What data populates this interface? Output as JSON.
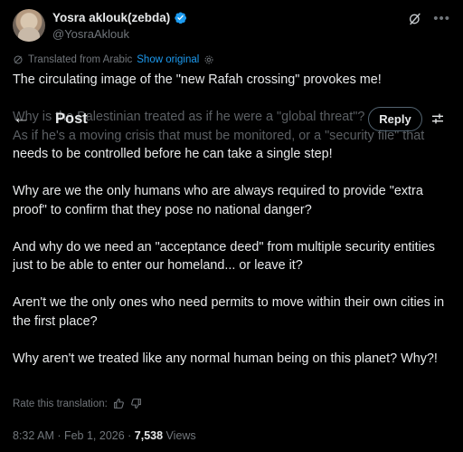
{
  "author": {
    "name": "Yosra aklouk(zebda)",
    "handle": "@YosraAklouk"
  },
  "translation": {
    "label": "Translated from Arabic",
    "show_original": "Show original"
  },
  "nav": {
    "title": "Post",
    "reply_label": "Reply"
  },
  "post": {
    "line1": "The circulating image of the \"new Rafah crossing\" provokes me!",
    "para2_a": "Why is the Palestinian treated as if he were a \"global threat\"?",
    "para2_b": "As if he's a moving crisis that must be monitored, or a \"security file\" that",
    "para2_c": "needs to be controlled before he can take a single step!",
    "para3": "Why are we the only humans who are always required to provide \"extra proof\" to confirm that they pose no national danger?",
    "para4": "And why do we need an \"acceptance deed\" from multiple security entities just to be able to enter our homeland... or leave it?",
    "para5": "Aren't we the only ones who need permits to move within their own cities in the first place?",
    "para6": "Why aren't we treated like any normal human being on this planet? Why?!"
  },
  "rate": {
    "label": "Rate this translation:"
  },
  "meta": {
    "time_date": "8:32 AM · Feb 1, 2026 · ",
    "views_count": "7,538",
    "views_label": " Views"
  },
  "colors": {
    "background": "#000000",
    "text": "#e7e9ea",
    "secondary": "#71767b",
    "accent": "#1d9bf0"
  }
}
